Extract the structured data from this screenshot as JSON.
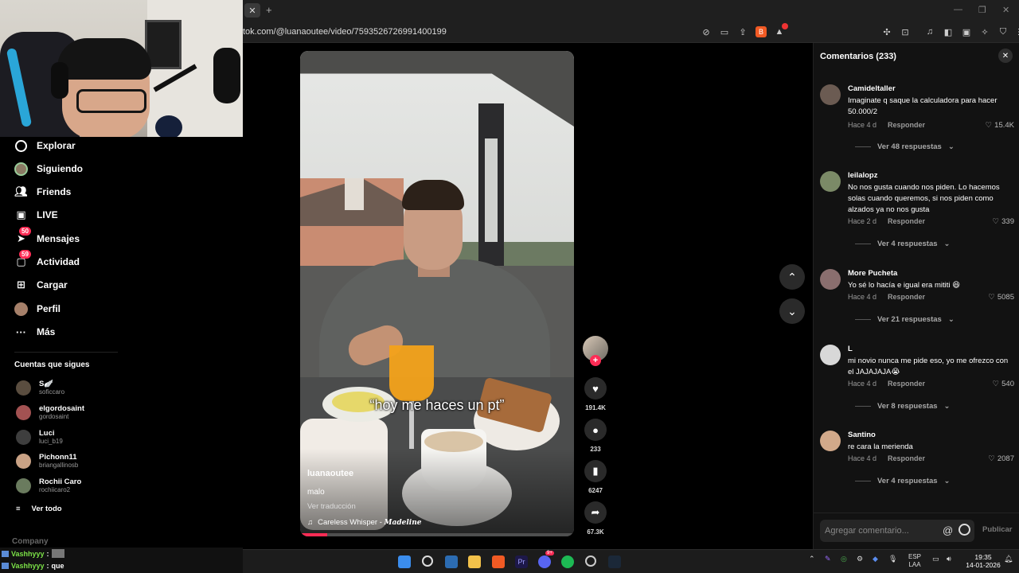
{
  "browser": {
    "tab_close_label": "✕",
    "tab_new_label": "+",
    "url": "tok.com/@luanaoutee/video/7593526726991400199",
    "window_controls": [
      "—",
      "❐",
      "✕"
    ]
  },
  "sidebar": {
    "items": [
      {
        "label": "Explorar",
        "icon": "compass-icon"
      },
      {
        "label": "Siguiendo",
        "icon": "avatar-icon"
      },
      {
        "label": "Friends",
        "icon": "friends-icon"
      },
      {
        "label": "LIVE",
        "icon": "live-icon"
      },
      {
        "label": "Mensajes",
        "icon": "message-icon",
        "badge": "50"
      },
      {
        "label": "Actividad",
        "icon": "activity-icon",
        "badge": "59"
      },
      {
        "label": "Cargar",
        "icon": "upload-icon"
      },
      {
        "label": "Perfil",
        "icon": "profile-icon"
      },
      {
        "label": "Más",
        "icon": "more-icon"
      }
    ],
    "following_title": "Cuentas que sigues",
    "following": [
      {
        "name": "S🪽",
        "user": "soficcaro",
        "color": "#5a4d3f"
      },
      {
        "name": "elgordosaint",
        "user": "gordosaint",
        "color": "#a35252"
      },
      {
        "name": "Luci",
        "user": "luci_b19",
        "color": "#3e3e3e"
      },
      {
        "name": "Pichonn11",
        "user": "briangallinosb",
        "color": "#c9a285"
      },
      {
        "name": "Rochii Caro",
        "user": "rochiicaro2",
        "color": "#6a7b5e"
      }
    ],
    "see_all": "Ver todo",
    "company": "Company"
  },
  "chat": {
    "lines": [
      {
        "user": "Vashhyyy",
        "sep": " :",
        "msg": ""
      },
      {
        "user": "Vashhyyy",
        "sep": " :",
        "msg": "que"
      }
    ]
  },
  "video": {
    "caption": "“hoy me haces un pt”",
    "author": "luanaoutee",
    "description": "malo",
    "translate": "Ver traducción",
    "music_title": "Careless Whisper - ",
    "music_artist": "Madeline",
    "progress_percent": 10,
    "actions": {
      "likes": "191.4K",
      "comments": "233",
      "saves": "6247",
      "shares": "67.3K"
    }
  },
  "comments": {
    "header": "Comentarios (233)",
    "items": [
      {
        "user": "Camideltaller",
        "text": "Imaginate q saque la calculadora para hacer 50.000/2",
        "time": "Hace 4 d",
        "reply": "Responder",
        "likes": "15.4K",
        "more": "Ver 48 respuestas",
        "avatar": "#6b5b52"
      },
      {
        "user": "leilalopz",
        "text": "No nos gusta cuando nos piden. Lo hacemos solas cuando queremos, si nos piden como alzados ya no nos gusta",
        "time": "Hace 2 d",
        "reply": "Responder",
        "likes": "339",
        "more": "Ver 4 respuestas",
        "avatar": "#7b8a67"
      },
      {
        "user": "More Pucheta",
        "text": "Yo sé lo hacía e igual era mititi 😆",
        "time": "Hace 4 d",
        "reply": "Responder",
        "likes": "5085",
        "more": "Ver 21 respuestas",
        "avatar": "#8a6e6e"
      },
      {
        "user": "L",
        "text": "mi novio nunca me pide eso, yo me ofrezco con el JAJAJAJA😭",
        "time": "Hace 4 d",
        "reply": "Responder",
        "likes": "540",
        "more": "Ver 8 respuestas",
        "avatar": "#d8d8d8"
      },
      {
        "user": "Santino",
        "text": "re cara la merienda",
        "time": "Hace 4 d",
        "reply": "Responder",
        "likes": "2087",
        "more": "Ver 4 respuestas",
        "avatar": "#d2a98a"
      }
    ],
    "input_placeholder": "Agregar comentario...",
    "publish": "Publicar"
  },
  "taskbar": {
    "lang_top": "ESP",
    "lang_bottom": "LAA",
    "time": "19:35",
    "date": "14-01-2026",
    "discord_badge": "9+"
  },
  "colors": {
    "accent": "#fe2c55",
    "panel": "#121212",
    "chat_user": "#7be047"
  }
}
